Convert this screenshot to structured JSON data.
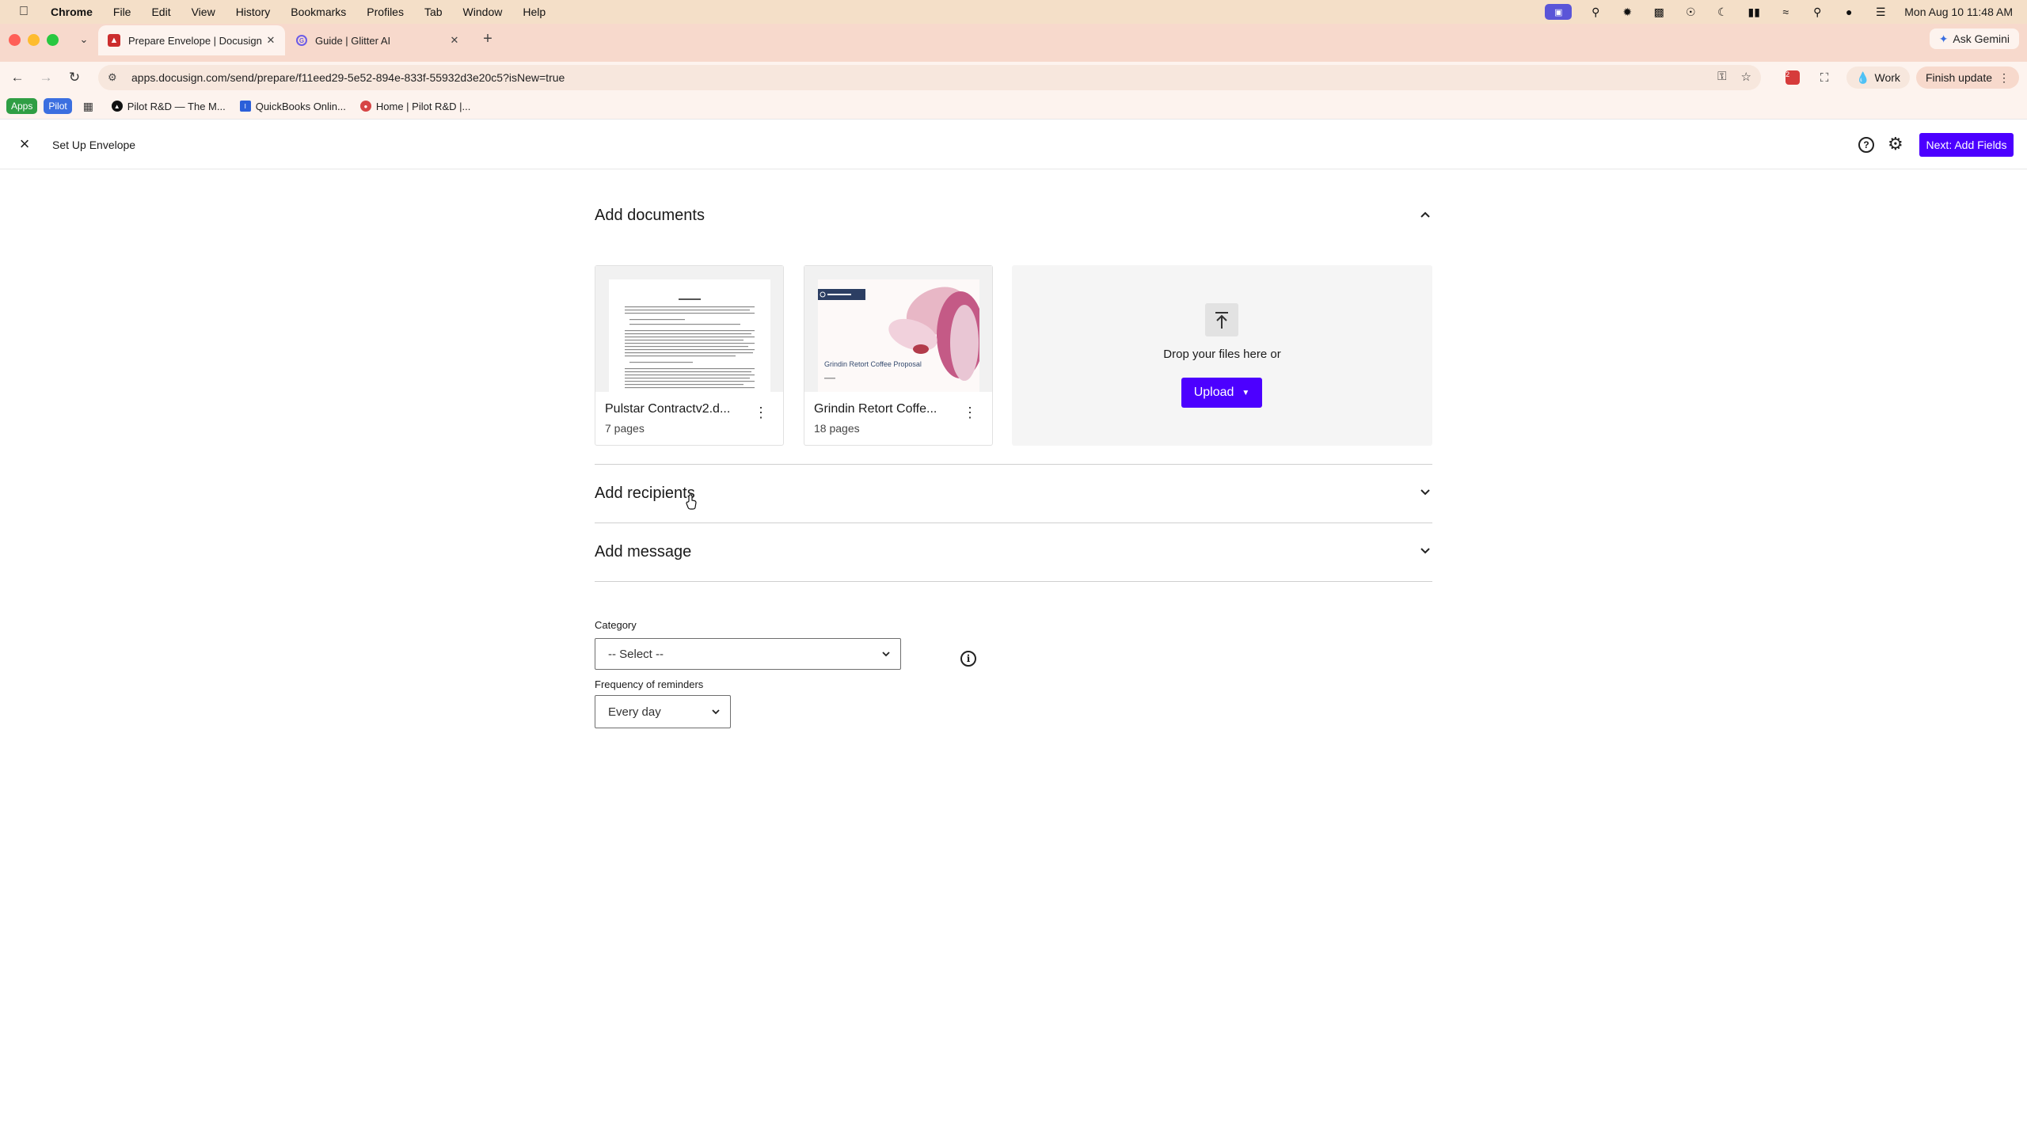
{
  "menubar": {
    "app_name": "Chrome",
    "menus": [
      "File",
      "Edit",
      "View",
      "History",
      "Bookmarks",
      "Profiles",
      "Tab",
      "Window",
      "Help"
    ],
    "clock": "Mon Aug 10  11:48 AM"
  },
  "tabs": [
    {
      "title": "Prepare Envelope | Docusign",
      "favicon": "docusign-icon"
    },
    {
      "title": "Guide | Glitter AI",
      "favicon": "glitter-icon"
    }
  ],
  "ask_gemini": "Ask Gemini",
  "address_bar": {
    "url": "apps.docusign.com/send/prepare/f11eed29-5e52-894e-833f-55932d3e20c5?isNew=true"
  },
  "profile": {
    "label": "Work"
  },
  "finish_update": "Finish update",
  "bookmarks": {
    "apps": "Apps",
    "pilot": "Pilot",
    "items": [
      "Pilot R&D — The M...",
      "QuickBooks Onlin...",
      "Home | Pilot R&D |..."
    ]
  },
  "header": {
    "title": "Set Up Envelope",
    "next_button": "Next: Add Fields"
  },
  "sections": {
    "documents": "Add documents",
    "recipients": "Add recipients",
    "message": "Add message"
  },
  "documents": [
    {
      "name": "Pulstar Contractv2.d...",
      "pages": "7 pages"
    },
    {
      "name": "Grindin Retort Coffe...",
      "pages": "18 pages",
      "thumb_caption": "Grindin Retort Coffee Proposal"
    }
  ],
  "dropzone": {
    "text": "Drop your files here or",
    "upload_label": "Upload"
  },
  "category": {
    "label": "Category",
    "value": "-- Select --"
  },
  "reminders": {
    "label": "Frequency of reminders",
    "value": "Every day"
  },
  "colors": {
    "accent": "#4c00ff",
    "menubar_bg": "#f4dfc8",
    "tabstrip_bg": "#f7d9cc"
  }
}
